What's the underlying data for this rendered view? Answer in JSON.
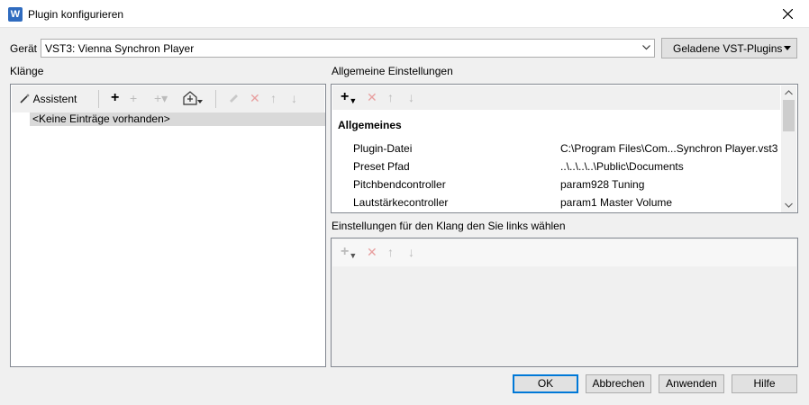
{
  "window": {
    "title": "Plugin konfigurieren",
    "app_icon": "plugin-app-icon"
  },
  "device": {
    "label": "Gerät",
    "value": "VST3: Vienna Synchron Player",
    "loaded_plugins_button": "Geladene VST-Plugins"
  },
  "sounds": {
    "label": "Klänge",
    "assistant": "Assistent",
    "empty_entry": "<Keine Einträge vorhanden>"
  },
  "general": {
    "label": "Allgemeine Einstellungen",
    "section": "Allgemeines",
    "rows": [
      {
        "key": "Plugin-Datei",
        "value": "C:\\Program Files\\Com...Synchron Player.vst3"
      },
      {
        "key": "Preset Pfad",
        "value": "..\\..\\..\\..\\Public\\Documents"
      },
      {
        "key": "Pitchbendcontroller",
        "value": "param928 Tuning"
      },
      {
        "key": "Lautstärkecontroller",
        "value": "param1 Master Volume"
      }
    ]
  },
  "sound_settings": {
    "label": "Einstellungen für den Klang den Sie links wählen"
  },
  "buttons": {
    "ok": "OK",
    "cancel": "Abbrechen",
    "apply": "Anwenden",
    "help": "Hilfe"
  },
  "colors": {
    "accent": "#0078d7",
    "delete_red": "#e06060",
    "selection": "#d9d9d9"
  }
}
